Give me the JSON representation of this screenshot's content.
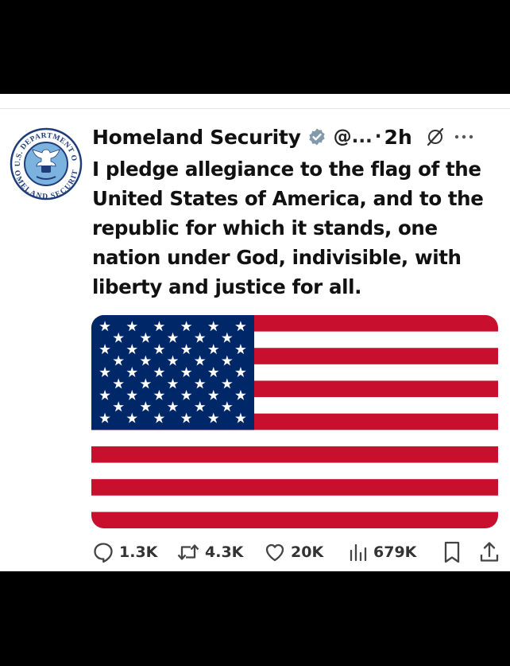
{
  "tweet": {
    "author_name": "Homeland Security",
    "handle": "@...",
    "separator": "·",
    "time": "2h",
    "text": "I pledge allegiance to the flag of the United States of America, and to the republic for which it stands, one nation under God, indivisible, with liberty and justice for all.",
    "avatar": {
      "type": "seal",
      "ring_text": "U.S. DEPARTMENT OF HOMELAND SECURITY",
      "colors": {
        "ring": "#1f3d7a",
        "inner": "#7cb3de",
        "eagle": "#ffffff"
      }
    },
    "media": {
      "icon": "us-flag",
      "colors": {
        "red": "#c8102e",
        "blue": "#002868",
        "white": "#ffffff"
      }
    },
    "actions": {
      "replies": {
        "icon": "reply-icon",
        "count": "1.3K"
      },
      "reposts": {
        "icon": "repost-icon",
        "count": "4.3K"
      },
      "likes": {
        "icon": "heart-icon",
        "count": "20K"
      },
      "views": {
        "icon": "views-icon",
        "count": "679K"
      },
      "bookmark": {
        "icon": "bookmark-icon"
      },
      "share": {
        "icon": "share-icon"
      }
    }
  },
  "colors": {
    "verified": "#829aab",
    "text": "#111111",
    "muted": "#333333"
  }
}
